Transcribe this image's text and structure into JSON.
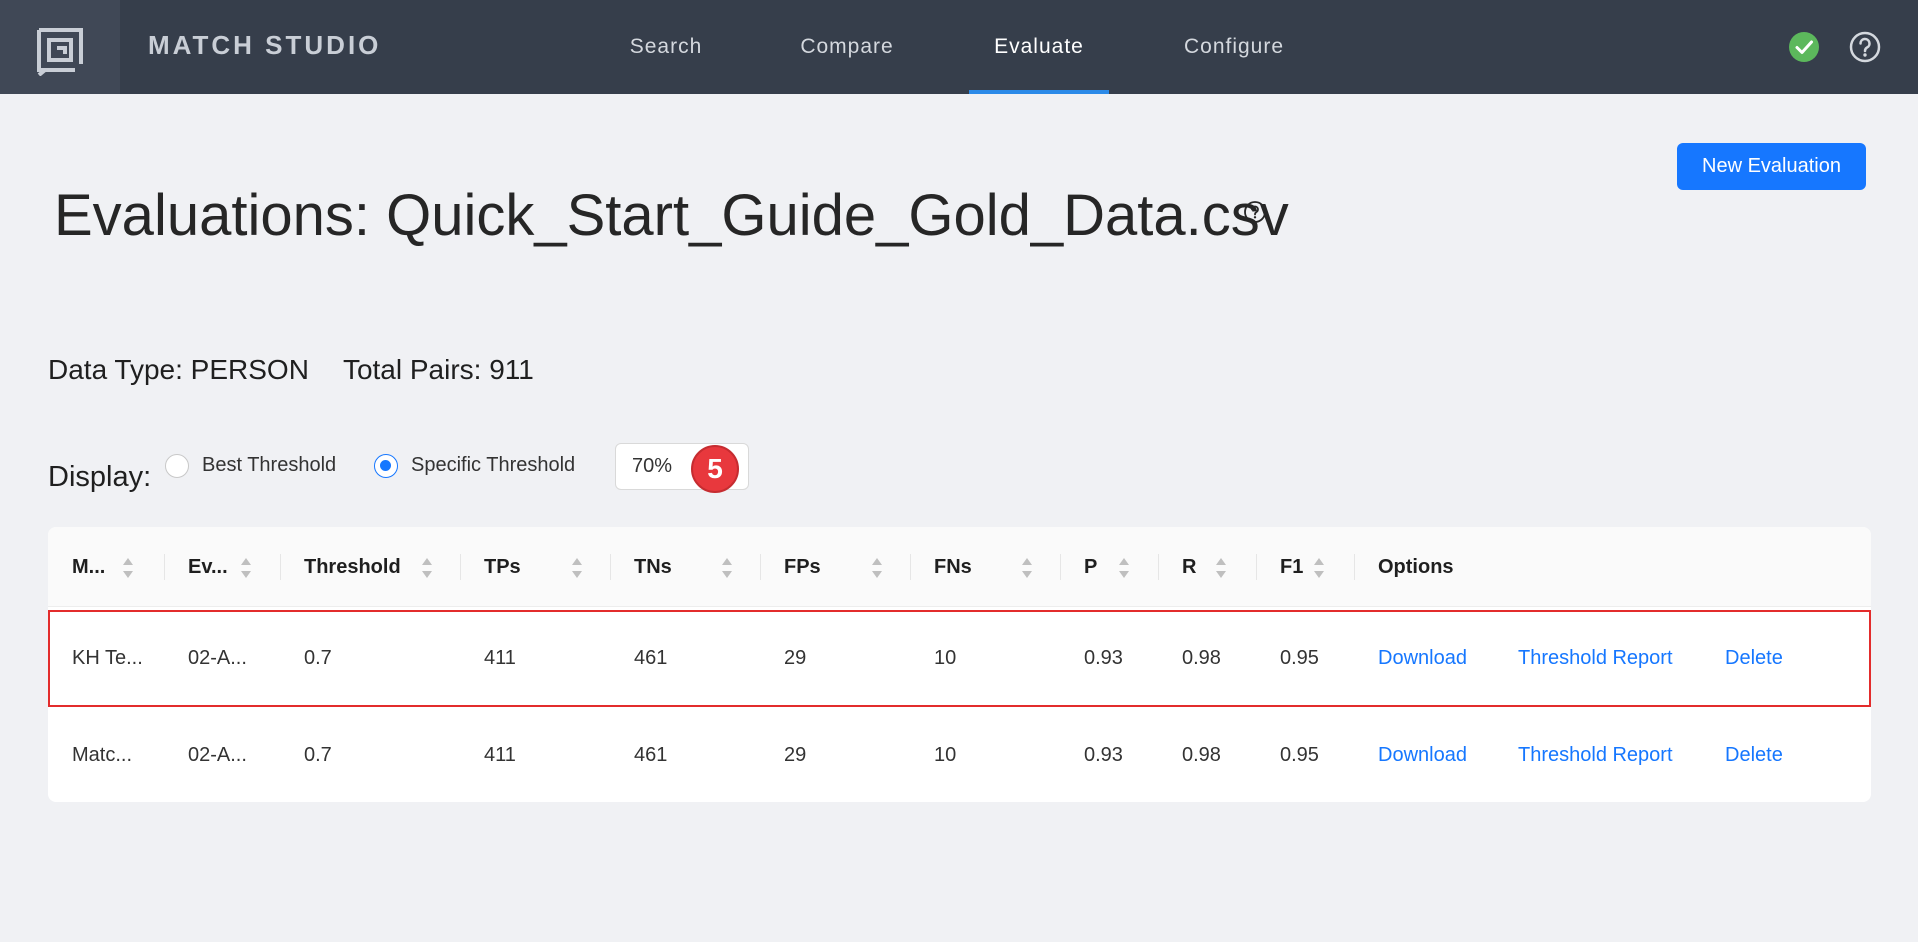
{
  "app": {
    "name": "MATCH STUDIO"
  },
  "nav": {
    "tabs": [
      {
        "label": "Search",
        "active": false
      },
      {
        "label": "Compare",
        "active": false
      },
      {
        "label": "Evaluate",
        "active": true
      },
      {
        "label": "Configure",
        "active": false
      }
    ]
  },
  "icons": {
    "logo": "match-studio-logo",
    "status": "check-circle-icon",
    "help": "question-circle-icon",
    "sort": "sort-caret-icon"
  },
  "colors": {
    "nav_bg": "#363e4b",
    "accent": "#1677ff",
    "status_ok": "#5cb85c",
    "highlight": "#e32c2c",
    "badge": "#e8383d"
  },
  "header": {
    "new_button": "New Evaluation"
  },
  "page": {
    "title": "Evaluations: Quick_Start_Guide_Gold_Data.csv"
  },
  "summary": {
    "data_type": "Data Type: PERSON",
    "total_pairs": "Total Pairs: 911"
  },
  "display": {
    "label": "Display:",
    "options": [
      {
        "label": "Best Threshold",
        "checked": false
      },
      {
        "label": "Specific Threshold",
        "checked": true
      }
    ],
    "threshold_value": "70%",
    "step_badge": "5"
  },
  "table": {
    "columns": [
      "M...",
      "Ev...",
      "Threshold",
      "TPs",
      "TNs",
      "FPs",
      "FNs",
      "P",
      "R",
      "F1",
      "Options"
    ],
    "rows": [
      {
        "model": "KH Te...",
        "eval": "02-A...",
        "threshold": "0.7",
        "tps": "411",
        "tns": "461",
        "fps": "29",
        "fns": "10",
        "p": "0.93",
        "r": "0.98",
        "f1": "0.95",
        "download": "Download",
        "report": "Threshold Report",
        "delete": "Delete",
        "highlighted": true
      },
      {
        "model": "Matc...",
        "eval": "02-A...",
        "threshold": "0.7",
        "tps": "411",
        "tns": "461",
        "fps": "29",
        "fns": "10",
        "p": "0.93",
        "r": "0.98",
        "f1": "0.95",
        "download": "Download",
        "report": "Threshold Report",
        "delete": "Delete",
        "highlighted": false
      }
    ]
  }
}
